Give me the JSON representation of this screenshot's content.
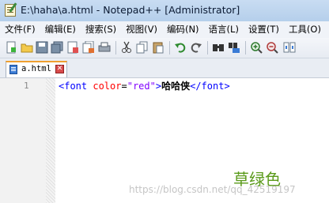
{
  "window": {
    "title": "E:\\haha\\a.html - Notepad++ [Administrator]"
  },
  "menu": {
    "items": [
      {
        "label": "文件(F)"
      },
      {
        "label": "编辑(E)"
      },
      {
        "label": "搜索(S)"
      },
      {
        "label": "视图(V)"
      },
      {
        "label": "编码(N)"
      },
      {
        "label": "语言(L)"
      },
      {
        "label": "设置(T)"
      },
      {
        "label": "工具(O)"
      }
    ]
  },
  "toolbar": {
    "buttons": [
      "new-file-icon",
      "open-file-icon",
      "save-icon",
      "save-all-icon",
      "close-icon",
      "close-all-icon",
      "print-icon",
      "cut-icon",
      "copy-icon",
      "paste-icon",
      "undo-icon",
      "redo-icon",
      "find-icon",
      "replace-icon",
      "zoom-in-icon",
      "zoom-out-icon",
      "sync-scroll-icon"
    ]
  },
  "tabs": [
    {
      "label": "a.html",
      "close": "✕",
      "active": true
    }
  ],
  "editor": {
    "line_number": "1",
    "code": {
      "open_tag_start": "<font",
      "attr_name": "color",
      "equals": "=",
      "attr_value": "\"red\"",
      "open_tag_end": ">",
      "text": "哈哈侠",
      "close_tag": "</font>"
    }
  },
  "overlay": {
    "green_text": "草绿色",
    "green_color": "#5a9a1a",
    "watermark": "https://blog.csdn.net/qq_42519197"
  },
  "colors": {
    "tag": "#0000ff",
    "attribute": "#ff0000",
    "string": "#8000ff",
    "tab_accent": "#f0a030"
  }
}
